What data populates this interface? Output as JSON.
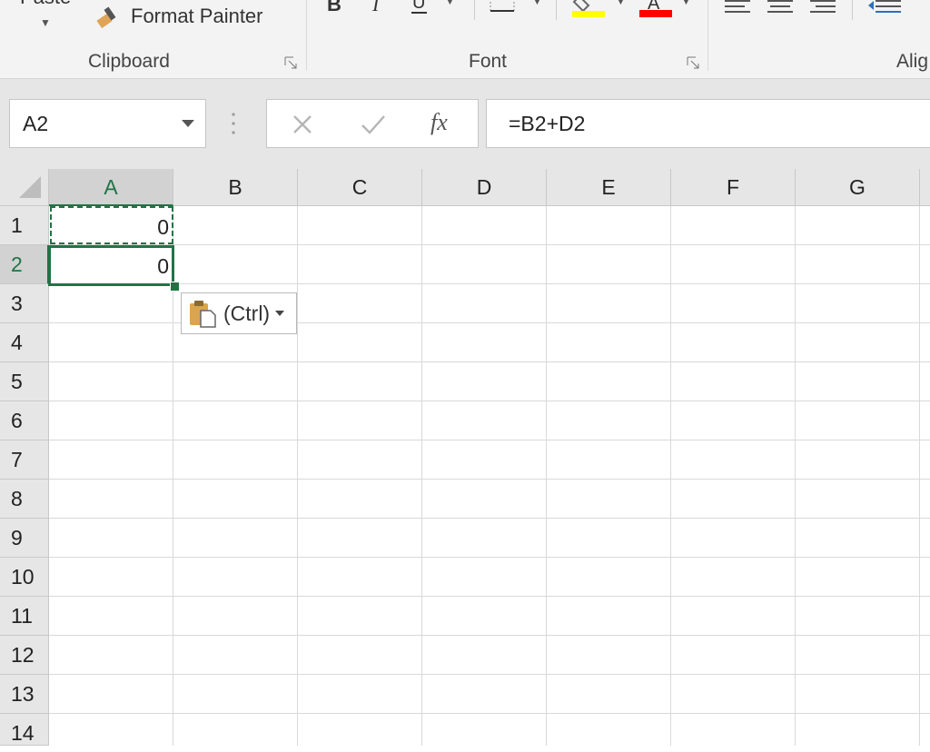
{
  "ribbon": {
    "paste_label": "Paste",
    "format_painter_label": "Format Painter",
    "groups": {
      "clipboard": "Clipboard",
      "font": "Font",
      "alignment": "Alig"
    },
    "icons": [
      "format-painter-icon",
      "bold-icon",
      "italic-icon",
      "underline-icon",
      "borders-icon",
      "fill-color-icon",
      "font-color-icon",
      "align-top-icon",
      "align-middle-icon",
      "align-bottom-icon",
      "decrease-indent-icon"
    ]
  },
  "formula_bar": {
    "name_box": "A2",
    "formula": "=B2+D2",
    "cancel_icon": "close-icon",
    "enter_icon": "checkmark-icon",
    "fx_label": "fx"
  },
  "sheet": {
    "columns": [
      "A",
      "B",
      "C",
      "D",
      "E",
      "F",
      "G"
    ],
    "rows": [
      "1",
      "2",
      "3",
      "4",
      "5",
      "6",
      "7",
      "8",
      "9",
      "10",
      "11",
      "12",
      "13",
      "14"
    ],
    "cells": {
      "A1": "0",
      "A2": "0"
    },
    "selected_cell": "A2",
    "copy_source": "A1"
  },
  "paste_options": {
    "label": "(Ctrl)"
  },
  "colors": {
    "accent": "#217346",
    "highlight_fill": "#ffff00",
    "font_color": "#ff0000"
  }
}
